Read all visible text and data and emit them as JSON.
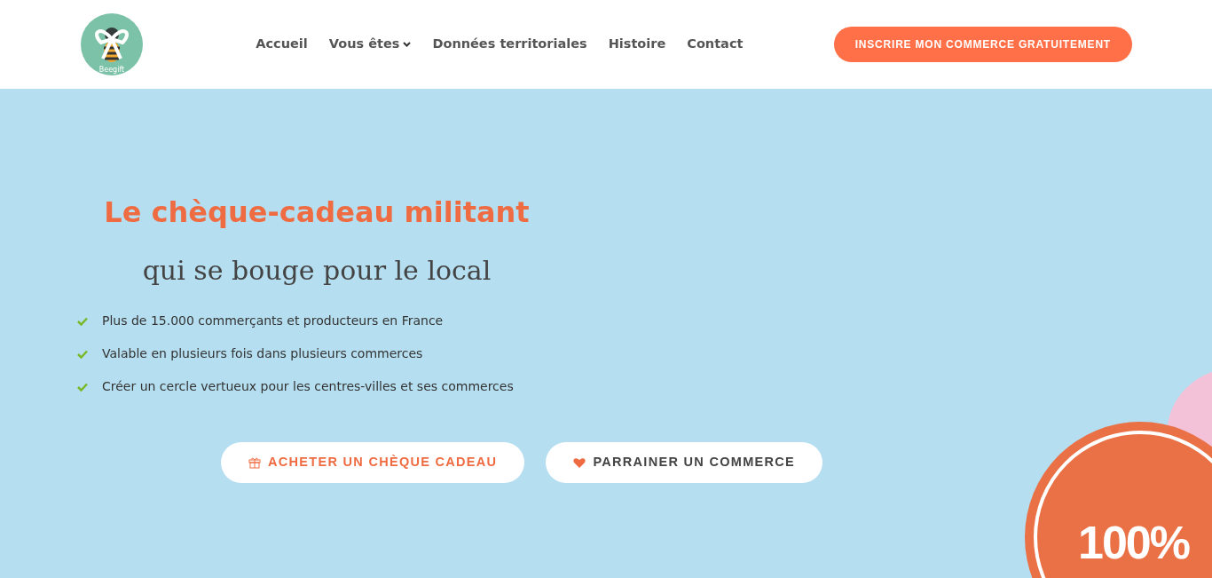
{
  "logo": {
    "text": "Beegift"
  },
  "nav": [
    {
      "label": "Accueil",
      "dropdown": false
    },
    {
      "label": "Vous êtes",
      "dropdown": true
    },
    {
      "label": "Données territoriales",
      "dropdown": false
    },
    {
      "label": "Histoire",
      "dropdown": false
    },
    {
      "label": "Contact",
      "dropdown": false
    }
  ],
  "cta": "INSCRIRE MON COMMERCE GRATUITEMENT",
  "hero": {
    "title": "Le chèque-cadeau militant",
    "subtitle": "qui se bouge pour le local",
    "features": [
      "Plus de 15.000 commerçants et producteurs en France",
      "Valable en plusieurs fois dans plusieurs commerces",
      "Créer un cercle vertueux pour les centres-villes et ses commerces"
    ],
    "buttons": [
      {
        "label": "ACHETER UN CHÈQUE CADEAU",
        "kind": "accent"
      },
      {
        "label": "PARRAINER UN COMMERCE",
        "kind": "dark"
      }
    ],
    "badge": "100%"
  }
}
